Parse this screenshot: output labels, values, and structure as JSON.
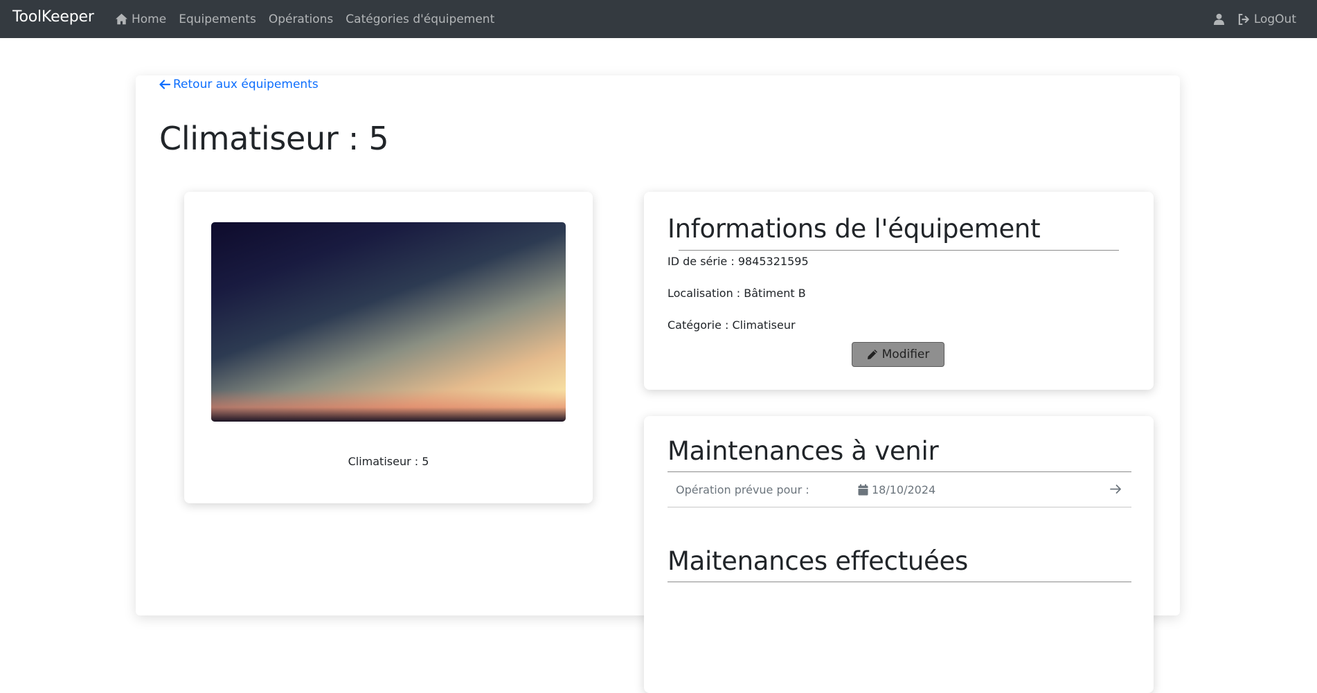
{
  "navbar": {
    "brand": "ToolKeeper",
    "links": [
      {
        "label": "Home",
        "icon": "home-icon"
      },
      {
        "label": "Equipements"
      },
      {
        "label": "Opérations"
      },
      {
        "label": "Catégories d'équipement"
      }
    ],
    "user_icon": "user-icon",
    "logout_label": "LogOut",
    "logout_icon": "sign-out-icon"
  },
  "back_link": {
    "label": "Retour aux équipements",
    "icon": "arrow-left-icon"
  },
  "page_title": "Climatiseur : 5",
  "image_card": {
    "image": "sunset-sky-photo",
    "caption": "Climatiseur : 5"
  },
  "info_card": {
    "title": "Informations de l'équipement",
    "serial": "ID de série : 9845321595",
    "location": "Localisation : Bâtiment B",
    "category": "Catégorie : Climatiseur",
    "edit_label": "Modifier",
    "edit_icon": "pencil-icon"
  },
  "maintenance": {
    "upcoming_title": "Maintenances à venir",
    "upcoming": [
      {
        "label": "Opération prévue pour :",
        "date": "18/10/2024",
        "icon": "calendar-icon"
      }
    ],
    "done_title": "Maitenances effectuées"
  },
  "colors": {
    "navbar_bg": "#343a40",
    "link_blue": "#0d6efd",
    "edit_button_bg": "#8f8f8f"
  }
}
